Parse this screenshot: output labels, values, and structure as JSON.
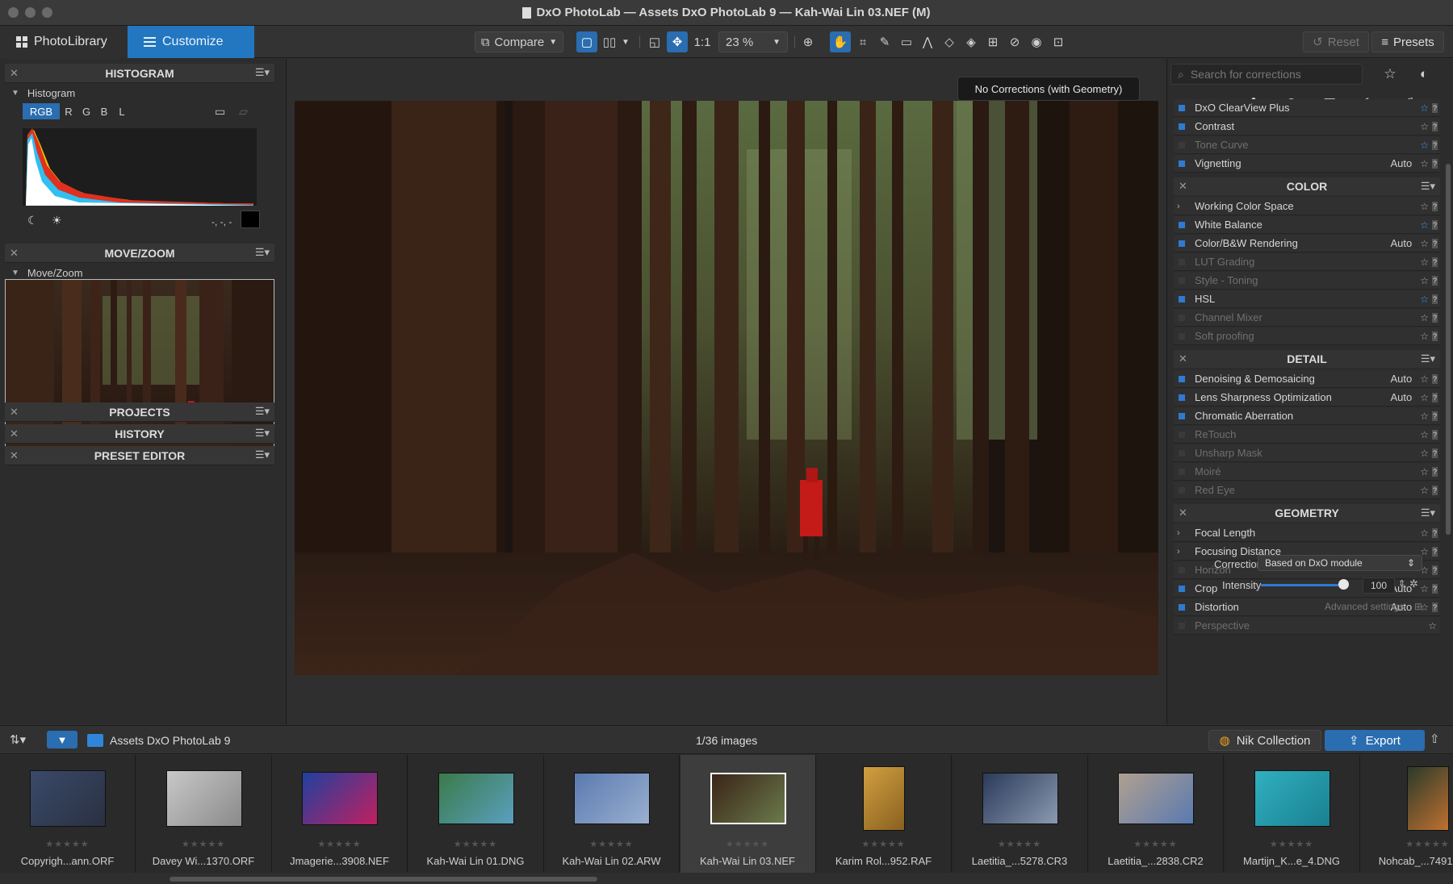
{
  "window": {
    "title": "DxO PhotoLab — Assets DxO PhotoLab 9 — Kah-Wai Lin 03.NEF (M)"
  },
  "tabs": {
    "photolibrary": "PhotoLibrary",
    "customize": "Customize"
  },
  "toolbar": {
    "compare": "Compare",
    "one_to_one": "1:1",
    "zoom": "23 %",
    "reset": "Reset",
    "presets": "Presets"
  },
  "tooltip": "No Corrections (with Geometry)",
  "left": {
    "histogram_title": "HISTOGRAM",
    "histogram_sub": "Histogram",
    "channels": [
      "RGB",
      "R",
      "G",
      "B",
      "L"
    ],
    "readout": "-, -, -",
    "movezoom_title": "MOVE/ZOOM",
    "movezoom_sub": "Move/Zoom",
    "projects": "PROJECTS",
    "history": "HISTORY",
    "preset_editor": "PRESET EDITOR"
  },
  "right": {
    "search_placeholder": "Search for corrections",
    "light_items": [
      {
        "label": "DxO ClearView Plus",
        "auto": "",
        "on": true,
        "fav": true
      },
      {
        "label": "Contrast",
        "auto": "",
        "on": true,
        "fav": false
      },
      {
        "label": "Tone Curve",
        "auto": "",
        "on": false,
        "fav": true
      },
      {
        "label": "Vignetting",
        "auto": "Auto",
        "on": true,
        "fav": false
      }
    ],
    "color_title": "COLOR",
    "color_items": [
      {
        "label": "Working Color Space",
        "auto": "",
        "on": true,
        "fav": false,
        "arrow": true
      },
      {
        "label": "White Balance",
        "auto": "",
        "on": true,
        "fav": true
      },
      {
        "label": "Color/B&W Rendering",
        "auto": "Auto",
        "on": true,
        "fav": false
      },
      {
        "label": "LUT Grading",
        "auto": "",
        "on": false,
        "fav": false
      },
      {
        "label": "Style - Toning",
        "auto": "",
        "on": false,
        "fav": false
      },
      {
        "label": "HSL",
        "auto": "",
        "on": true,
        "fav": true
      },
      {
        "label": "Channel Mixer",
        "auto": "",
        "on": false,
        "fav": false
      },
      {
        "label": "Soft proofing",
        "auto": "",
        "on": false,
        "fav": false
      }
    ],
    "detail_title": "DETAIL",
    "detail_items": [
      {
        "label": "Denoising & Demosaicing",
        "auto": "Auto",
        "on": true,
        "fav": false
      },
      {
        "label": "Lens Sharpness Optimization",
        "auto": "Auto",
        "on": true,
        "fav": false
      },
      {
        "label": "Chromatic Aberration",
        "auto": "",
        "on": true,
        "fav": false
      },
      {
        "label": "ReTouch",
        "auto": "",
        "on": false,
        "fav": false
      },
      {
        "label": "Unsharp Mask",
        "auto": "",
        "on": false,
        "fav": false
      },
      {
        "label": "Moiré",
        "auto": "",
        "on": false,
        "fav": false
      },
      {
        "label": "Red Eye",
        "auto": "",
        "on": false,
        "fav": false
      }
    ],
    "geometry_title": "GEOMETRY",
    "geometry_items": [
      {
        "label": "Focal Length",
        "auto": "",
        "on": true,
        "fav": false,
        "arrow": true
      },
      {
        "label": "Focusing Distance",
        "auto": "",
        "on": true,
        "fav": false,
        "arrow": true
      },
      {
        "label": "Horizon",
        "auto": "",
        "on": false,
        "fav": false
      },
      {
        "label": "Crop",
        "auto": "Auto",
        "on": true,
        "fav": false
      },
      {
        "label": "Distortion",
        "auto": "Auto",
        "on": true,
        "fav": false
      }
    ],
    "correction_label": "Correction",
    "correction_value": "Based on DxO module",
    "intensity_label": "Intensity",
    "intensity_value": "100",
    "advanced": "Advanced settings",
    "perspective": "Perspective"
  },
  "bottom": {
    "folder": "Assets DxO PhotoLab 9",
    "count": "1/36 images",
    "nik": "Nik Collection",
    "export": "Export"
  },
  "thumbs": [
    "Copyrigh...ann.ORF",
    "Davey Wi...1370.ORF",
    "Jmagerie...3908.NEF",
    "Kah-Wai Lin 01.DNG",
    "Kah-Wai Lin 02.ARW",
    "Kah-Wai Lin 03.NEF",
    "Karim Rol...952.RAF",
    "Laetitia_...5278.CR3",
    "Laetitia_...2838.CR2",
    "Martijn_K...e_4.DNG",
    "Nohcab_...7491.NEF"
  ],
  "stars": "★★★★★"
}
